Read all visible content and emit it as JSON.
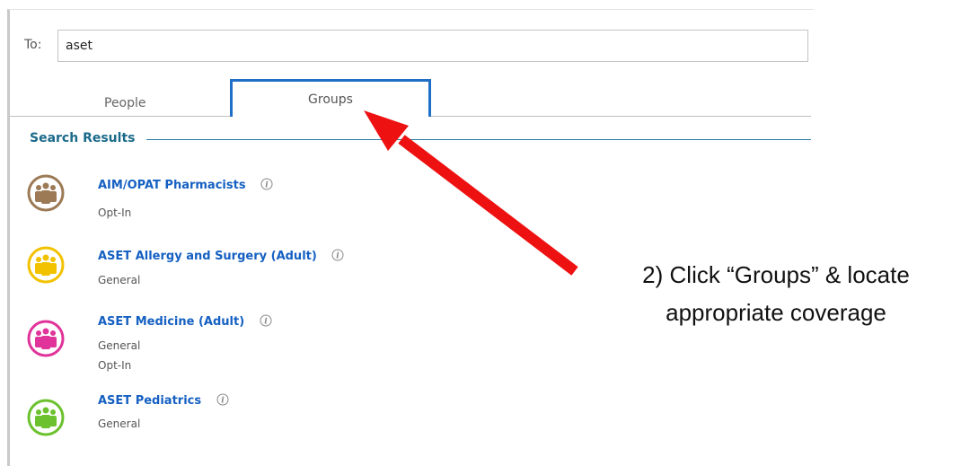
{
  "recipient": {
    "label": "To:",
    "value": "aset"
  },
  "tabs": [
    {
      "label": "People",
      "active": false
    },
    {
      "label": "Groups",
      "active": true
    }
  ],
  "results": {
    "title": "Search Results"
  },
  "groups": [
    {
      "name": "AIM/OPAT Pharmacists",
      "lines": [
        "Opt-In"
      ],
      "color": "#9c7a55"
    },
    {
      "name": "ASET Allergy and Surgery (Adult)",
      "lines": [
        "General"
      ],
      "color": "#f2c200"
    },
    {
      "name": "ASET Medicine (Adult)",
      "lines": [
        "General",
        "Opt-In"
      ],
      "color": "#e0349a"
    },
    {
      "name": "ASET Pediatrics",
      "lines": [
        "General"
      ],
      "color": "#6cc12e"
    }
  ],
  "icons": {
    "group": "group-people-icon",
    "info": "info-icon"
  },
  "annotation": {
    "line1": "2) Click “Groups” & locate",
    "line2": "appropriate coverage",
    "arrow_color": "#ee1111"
  },
  "colors": {
    "tab_active_border": "#1f6fc6",
    "link": "#1560c2",
    "section_title": "#1a6a8a"
  }
}
